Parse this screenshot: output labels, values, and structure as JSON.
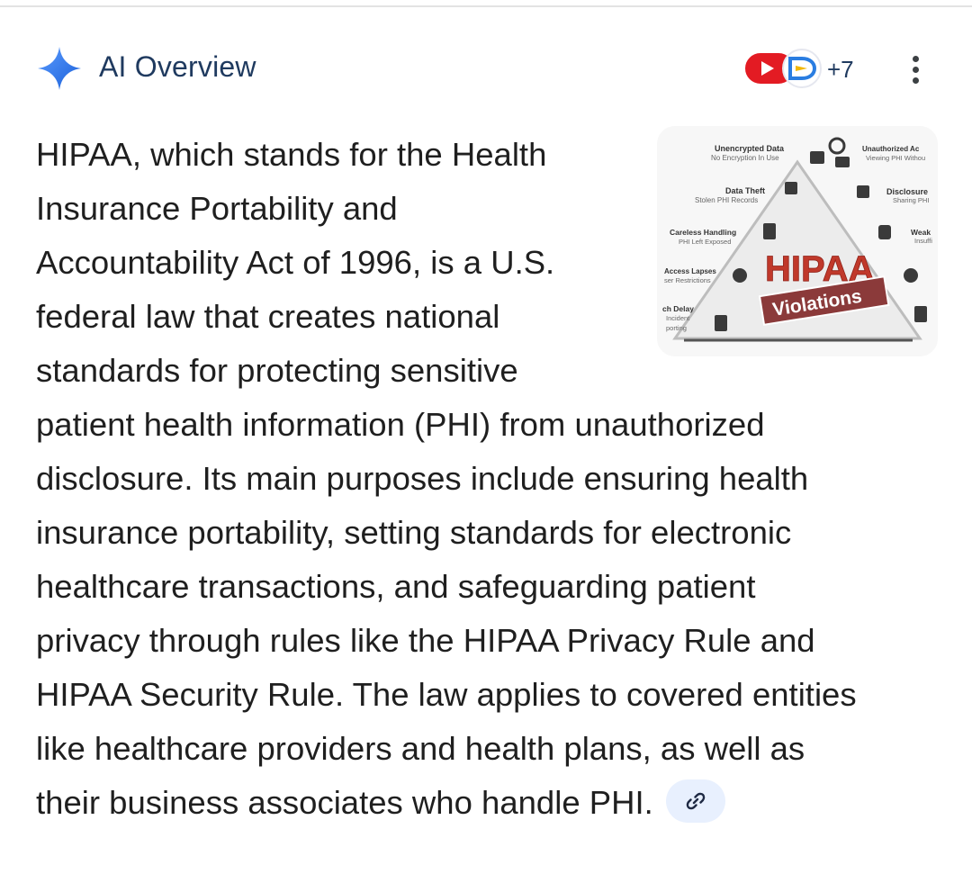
{
  "header": {
    "title": "AI Overview",
    "sources_more": "+7"
  },
  "thumbnail": {
    "main_text": "HIPAA",
    "ribbon_text": "Violations",
    "labels": [
      {
        "title": "Unencrypted Data",
        "sub": "No Encryption In Use"
      },
      {
        "title": "Unauthorized Ac",
        "sub": "Viewing PHI Withou"
      },
      {
        "title": "Data Theft",
        "sub": "Stolen PHI Records"
      },
      {
        "title": "Disclosure",
        "sub": "Sharing PHI"
      },
      {
        "title": "Careless Handling",
        "sub": "PHI Left Exposed"
      },
      {
        "title": "Weak",
        "sub": "Insuffi"
      },
      {
        "title": "Access Lapses",
        "sub": "ser Restrictions"
      },
      {
        "title": "ch Delay",
        "sub": "Incident"
      },
      {
        "title": "",
        "sub": "porting"
      }
    ]
  },
  "overview": {
    "lines": [
      "HIPAA, which stands for the Health",
      "Insurance Portability and",
      "Accountability Act of 1996, is a U.S.",
      "federal law that creates national",
      "standards for protecting sensitive",
      "patient health information (PHI) from unauthorized",
      "disclosure. Its main purposes include ensuring health",
      "insurance portability, setting standards for electronic",
      "healthcare transactions, and safeguarding patient",
      "privacy through rules like the HIPAA Privacy Rule and",
      "HIPAA Security Rule. The law applies to covered entities",
      "like healthcare providers and health plans, as well as",
      "their business associates who handle PHI."
    ]
  },
  "icons": {
    "spark": "gemini-spark-icon",
    "youtube": "youtube-icon",
    "source": "source-favicon-icon",
    "more": "more-vert-icon",
    "link": "link-icon"
  },
  "colors": {
    "title": "#1f3a5f",
    "spark_gradient_start": "#4285f4",
    "spark_gradient_end": "#1a73e8",
    "chip_bg": "#e8f0fe",
    "hipaa_red": "#c0392b",
    "ribbon": "#8b3a3a"
  }
}
